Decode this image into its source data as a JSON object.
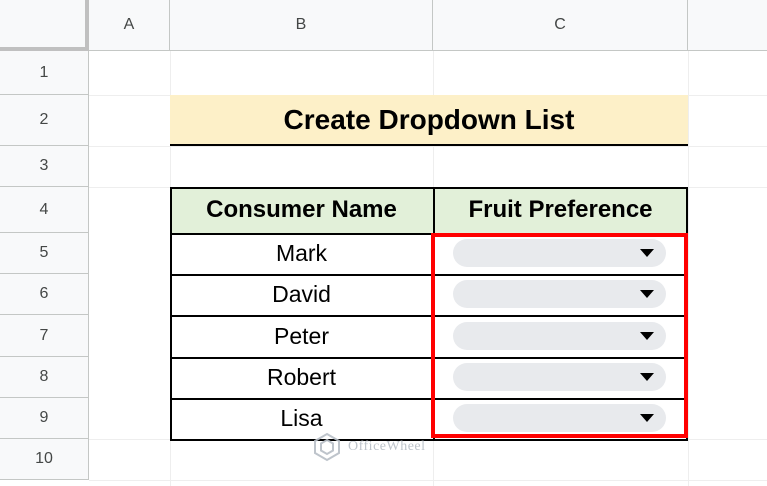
{
  "headers": {
    "columns": [
      "A",
      "B",
      "C"
    ],
    "rows": [
      "1",
      "2",
      "3",
      "4",
      "5",
      "6",
      "7",
      "8",
      "9",
      "10"
    ]
  },
  "title": "Create Dropdown List",
  "table": {
    "columns": [
      "Consumer Name",
      "Fruit Preference"
    ],
    "rows": [
      "Mark",
      "David",
      "Peter",
      "Robert",
      "Lisa"
    ]
  },
  "watermark": "OfficeWheel",
  "icons": {
    "dropdown": "chevron-down-icon",
    "watermark_logo": "officewheel-logo-icon"
  },
  "colors": {
    "title_bg": "#fdf0c8",
    "table_header_bg": "#e2f0d9",
    "dropdown_bg": "#e8eaed",
    "highlight": "#ff0000"
  }
}
